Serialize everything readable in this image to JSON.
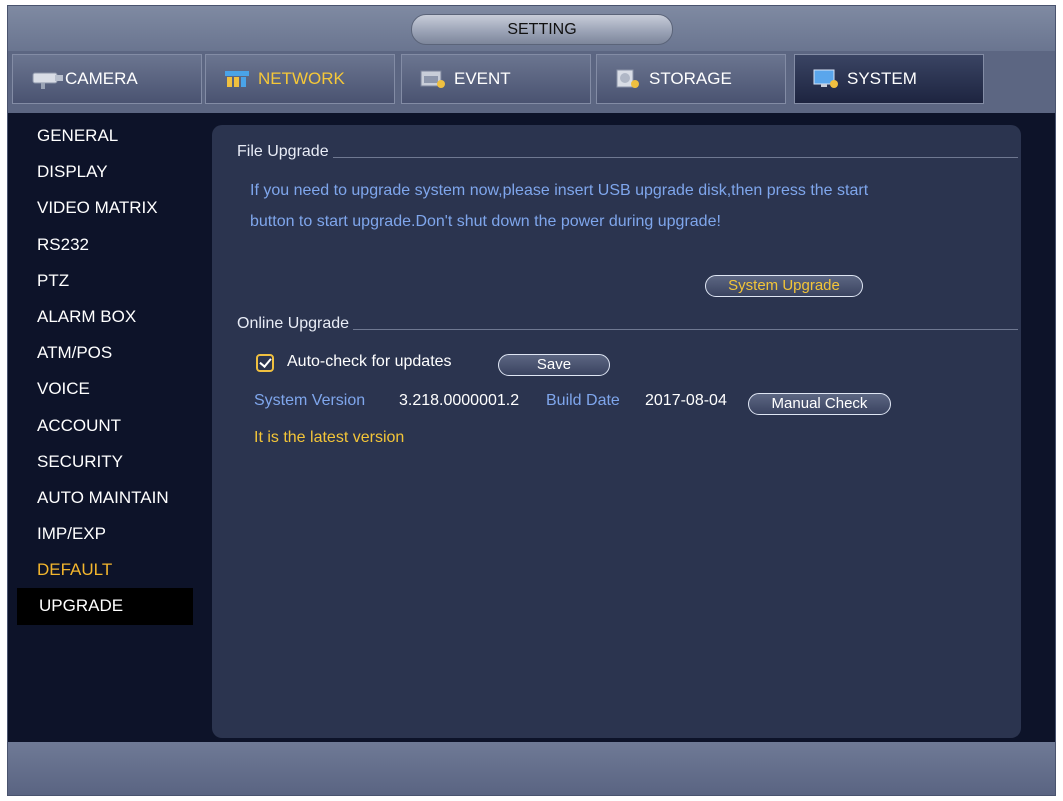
{
  "window": {
    "title": "SETTING"
  },
  "tabs": [
    {
      "label": "CAMERA",
      "icon": "camera-icon"
    },
    {
      "label": "NETWORK",
      "icon": "network-icon"
    },
    {
      "label": "EVENT",
      "icon": "event-icon"
    },
    {
      "label": "STORAGE",
      "icon": "storage-icon"
    },
    {
      "label": "SYSTEM",
      "icon": "system-icon"
    }
  ],
  "sidebar": {
    "items": [
      {
        "label": "GENERAL"
      },
      {
        "label": "DISPLAY"
      },
      {
        "label": "VIDEO MATRIX"
      },
      {
        "label": "RS232"
      },
      {
        "label": "PTZ"
      },
      {
        "label": "ALARM BOX"
      },
      {
        "label": "ATM/POS"
      },
      {
        "label": "VOICE"
      },
      {
        "label": "ACCOUNT"
      },
      {
        "label": "SECURITY"
      },
      {
        "label": "AUTO MAINTAIN"
      },
      {
        "label": "IMP/EXP"
      },
      {
        "label": "DEFAULT"
      },
      {
        "label": "UPGRADE"
      }
    ]
  },
  "file_upgrade": {
    "heading": "File Upgrade",
    "info_line1": "If you need to upgrade system now,please insert USB upgrade disk,then press the start",
    "info_line2": "button to start upgrade.Don't shut down the power during upgrade!",
    "button": "System Upgrade"
  },
  "online_upgrade": {
    "heading": "Online Upgrade",
    "auto_check_label": "Auto-check for updates",
    "auto_check_checked": true,
    "save_button": "Save",
    "version_label": "System Version",
    "version_value": "3.218.0000001.2",
    "build_label": "Build Date",
    "build_value": "2017-08-04",
    "manual_button": "Manual Check",
    "status": "It is the latest version"
  },
  "colors": {
    "accent_yellow": "#f3c538",
    "info_blue": "#7fa6ec",
    "panel_bg": "#2b344f",
    "frame_bg": "#0d1329"
  }
}
